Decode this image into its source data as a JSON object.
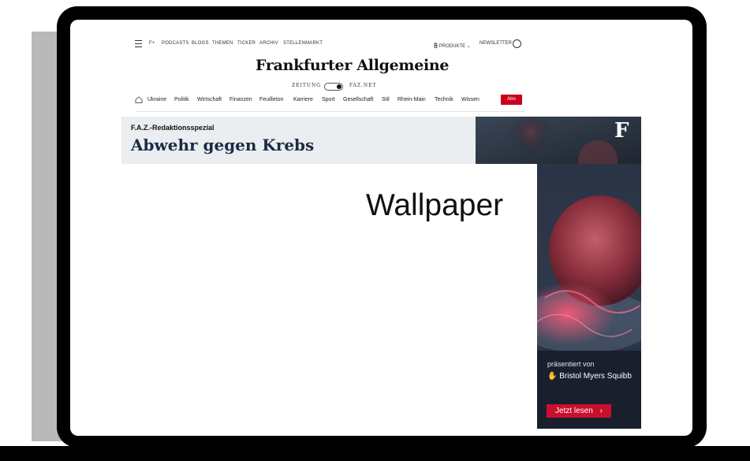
{
  "header": {
    "menu_items": [
      "F+",
      "PODCASTS",
      "BLOGS",
      "THEMEN",
      "TICKER",
      "ARCHIV",
      "STELLENMARKT"
    ],
    "produkte": "PRODUKTE",
    "newsletter": "NEWSLETTER",
    "logo_text": "Frankfurter Allgemeine",
    "toggle_left": "ZEITUNG",
    "toggle_right": "FAZ.NET"
  },
  "nav": {
    "items": [
      "Ukraine",
      "Politik",
      "Wirtschaft",
      "Finanzen",
      "Feuilleton",
      "Karriere",
      "Sport",
      "Gesellschaft",
      "Stil",
      "Rhein-Main",
      "Technik",
      "Wissen"
    ],
    "abo_label": "Abo"
  },
  "banner": {
    "kicker": "F.A.Z.-Redaktionsspezial",
    "title": "Abwehr gegen Krebs"
  },
  "wallpaper_label": "Wallpaper",
  "ad": {
    "logo_mark": "F",
    "presented_by": "präsentiert von",
    "sponsor": "Bristol Myers Squibb",
    "cta": "Jetzt lesen",
    "cta_arrow": "›"
  },
  "colors": {
    "accent_red": "#c8001e",
    "banner_bg": "#eaeef0",
    "ad_dark": "#1a1f2e"
  }
}
